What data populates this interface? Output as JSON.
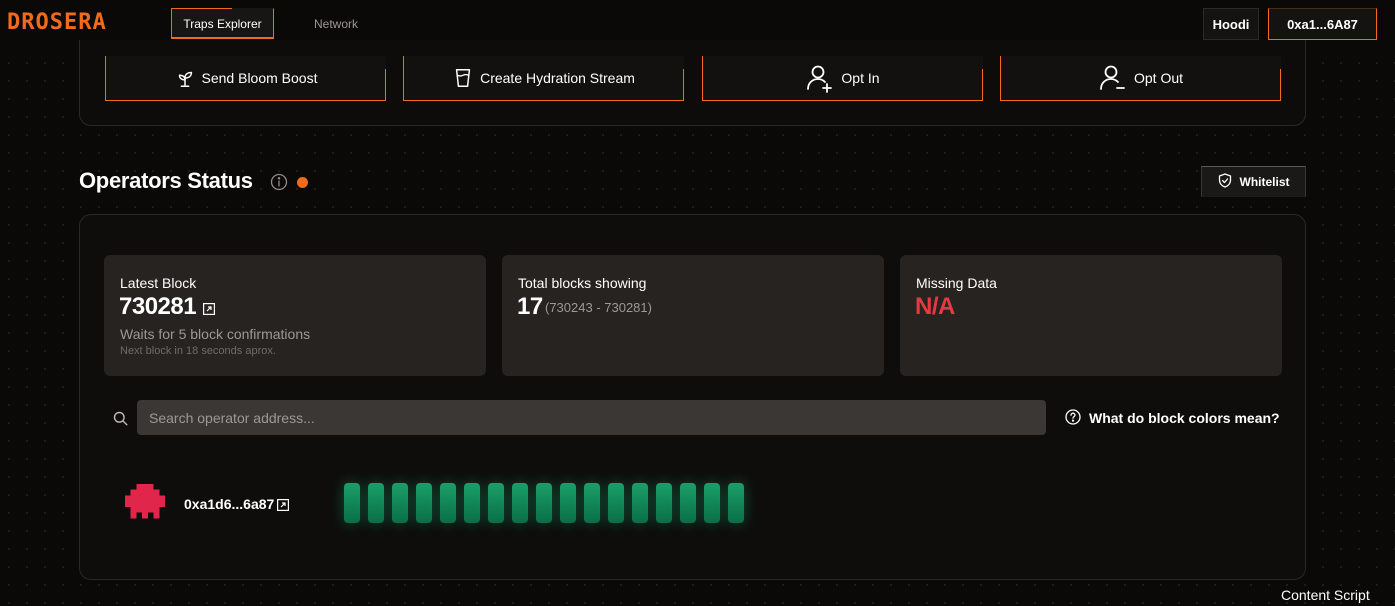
{
  "header": {
    "logo": "DROSERA",
    "tabs": [
      {
        "label": "Traps Explorer"
      },
      {
        "label": "Network"
      }
    ],
    "network": "Hoodi",
    "wallet": "0xa1...6A87"
  },
  "actions": [
    {
      "label": "Send Bloom Boost",
      "icon": "sprout-icon"
    },
    {
      "label": "Create Hydration Stream",
      "icon": "cup-icon"
    },
    {
      "label": "Opt In",
      "icon": "user-plus-icon"
    },
    {
      "label": "Opt Out",
      "icon": "user-minus-icon"
    }
  ],
  "operators": {
    "title": "Operators Status",
    "whitelist_label": "Whitelist",
    "cards": {
      "latest": {
        "label": "Latest Block",
        "value": "730281",
        "sub": "Waits for 5 block confirmations",
        "tiny": "Next block in 18 seconds aprox."
      },
      "total": {
        "label": "Total blocks showing",
        "value": "17",
        "range": "(730243 - 730281)"
      },
      "missing": {
        "label": "Missing Data",
        "value": "N/A"
      }
    },
    "search_placeholder": "Search operator address...",
    "help_label": "What do block colors mean?",
    "rows": [
      {
        "address": "0xa1d6...6a87",
        "blocks": 17
      }
    ]
  },
  "footer_note": "Content Script",
  "colors": {
    "accent": "#f26a1b",
    "error": "#e63a42",
    "block_ok": "#1aa06a",
    "avatar": "#e0264a"
  }
}
